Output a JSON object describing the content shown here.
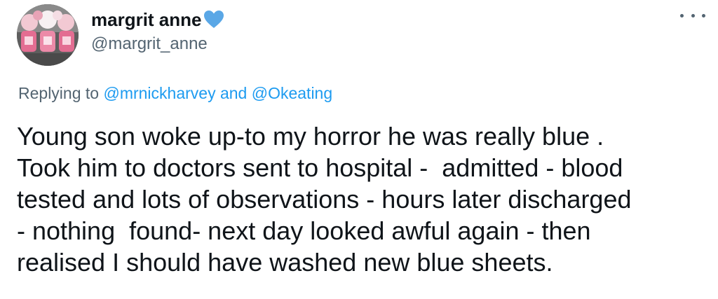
{
  "tweet": {
    "author": {
      "display_name": "margrit anne",
      "handle": "@margrit_anne",
      "badge_icon": "blue-heart-icon",
      "avatar_icon": "avatar-photo-icon"
    },
    "more_icon": "more-options-icon",
    "replying": {
      "prefix": "Replying to",
      "mention_1": "@mrnickharvey",
      "conjunction": "and",
      "mention_2": "@Okeating"
    },
    "text_lines": [
      "Young son woke up-to my horror he was really blue .",
      "Took him to doctors sent to hospital -  admitted - blood",
      "tested and lots of observations - hours later discharged",
      "- nothing  found- next day looked awful again - then",
      "realised I should have washed new blue sheets."
    ]
  },
  "colors": {
    "text": "#0f1419",
    "secondary": "#536471",
    "accent": "#1d9bf0",
    "heart": "#5aa7e6"
  }
}
